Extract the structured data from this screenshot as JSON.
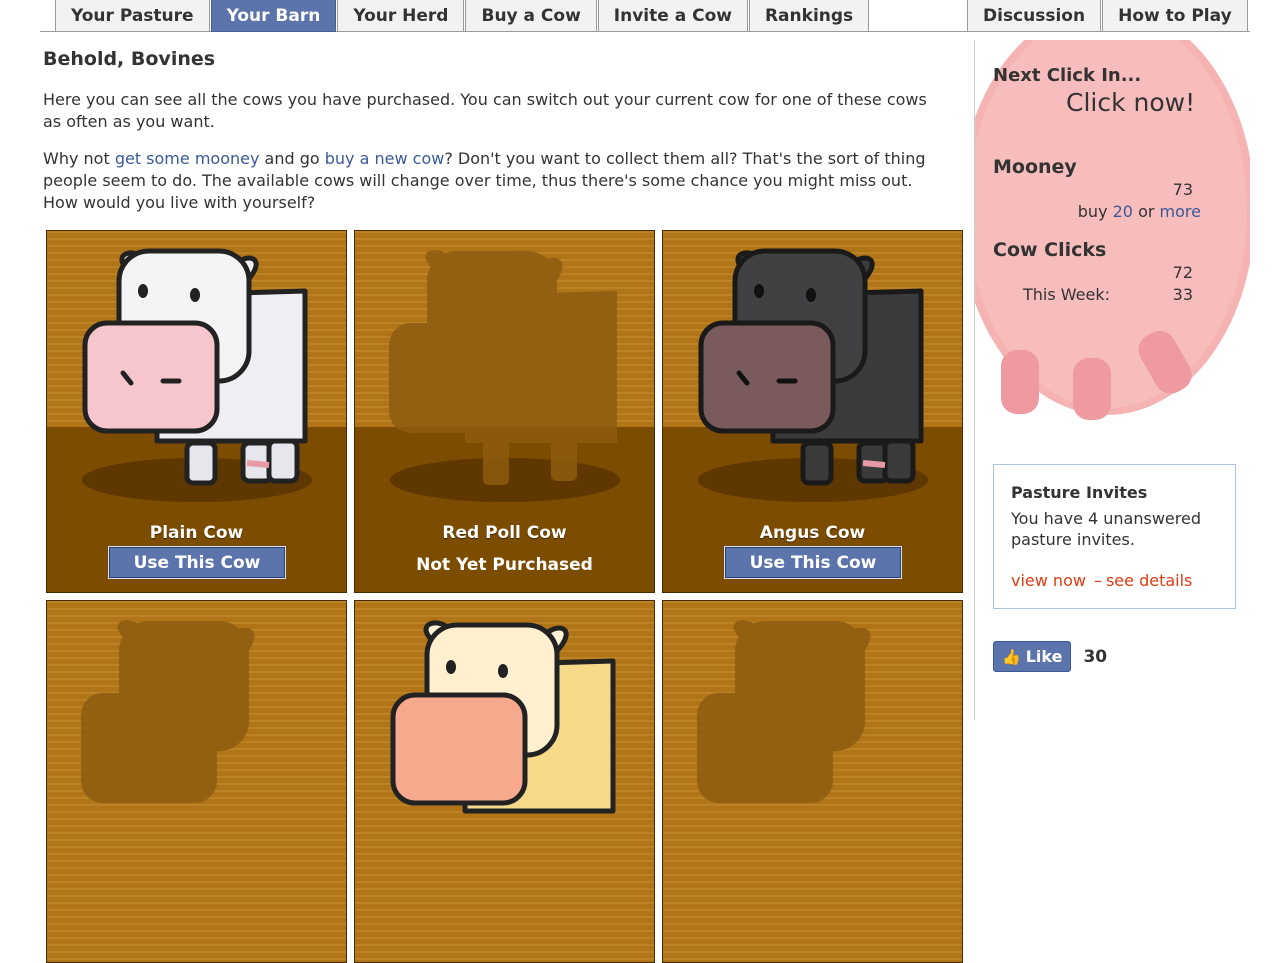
{
  "nav": {
    "left_tabs": [
      "Your Pasture",
      "Your Barn",
      "Your Herd",
      "Buy a Cow",
      "Invite a Cow",
      "Rankings"
    ],
    "right_tabs": [
      "Discussion",
      "How to Play"
    ],
    "active_tab": "Your Barn"
  },
  "main": {
    "heading": "Behold, Bovines",
    "intro": "Here you can see all the cows you have purchased. You can switch out your current cow for one of these cows as often as you want.",
    "p2_start": "Why not ",
    "p2_link1": "get some mooney",
    "p2_mid": " and go ",
    "p2_link2": "buy a new cow",
    "p2_end": "? Don't you want to collect them all? That's the sort of thing people seem to do. The available cows will change over time, thus there's some chance you might miss out. How would you live with yourself?"
  },
  "cows": [
    {
      "name": "Plain Cow",
      "status": "owned",
      "button": "Use This Cow"
    },
    {
      "name": "Red Poll Cow",
      "status": "locked",
      "status_text": "Not Yet Purchased"
    },
    {
      "name": "Angus Cow",
      "status": "owned",
      "button": "Use This Cow"
    }
  ],
  "sidebar": {
    "next_click_label": "Next Click In...",
    "click_now": "Click now!",
    "mooney_label": "Mooney",
    "mooney_value": "73",
    "buy_prefix": "buy",
    "buy_amount": "20",
    "buy_or": "or",
    "buy_more": "more",
    "cow_clicks_label": "Cow Clicks",
    "cow_clicks_value": "72",
    "this_week_label": "This Week:",
    "this_week_value": "33",
    "invites": {
      "title": "Pasture Invites",
      "text": "You have 4 unanswered pasture invites.",
      "view_now": "view now",
      "separator": "–",
      "see_details": "see details"
    },
    "like_label": "Like",
    "like_count": "30"
  },
  "colors": {
    "tab_active": "#5b75ac",
    "link": "#3b5998",
    "alert_link": "#dd3c10",
    "barn_wood": "#b87a18",
    "barn_floor": "#7c4c00",
    "udder_pink": "#f7b3b3"
  }
}
